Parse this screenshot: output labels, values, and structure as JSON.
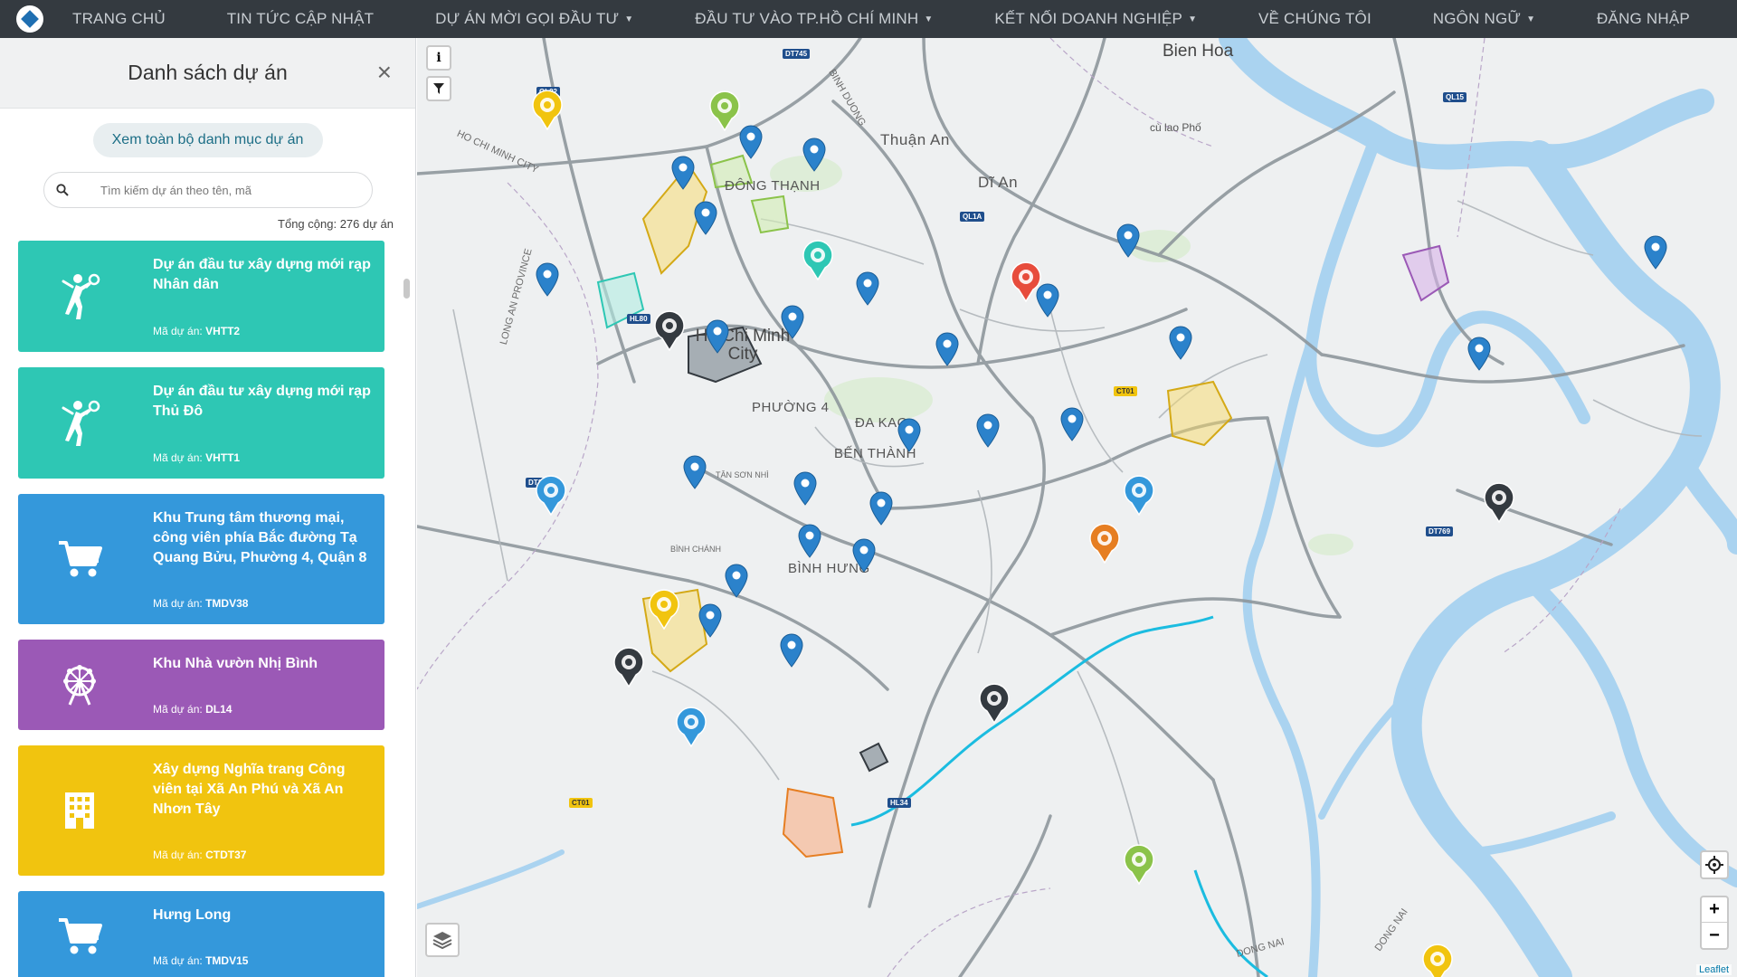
{
  "nav": {
    "items": [
      {
        "label": "TRANG CHỦ",
        "dropdown": false
      },
      {
        "label": "TIN TỨC CẬP NHẬT",
        "dropdown": false
      },
      {
        "label": "DỰ ÁN MỜI GỌI ĐẦU TƯ",
        "dropdown": true
      },
      {
        "label": "ĐẦU TƯ VÀO TP.HỒ CHÍ MINH",
        "dropdown": true
      },
      {
        "label": "KẾT NỐI DOANH NGHIỆP",
        "dropdown": true
      },
      {
        "label": "VỀ CHÚNG TÔI",
        "dropdown": false
      },
      {
        "label": "NGÔN NGỮ",
        "dropdown": true
      },
      {
        "label": "ĐĂNG NHẬP",
        "dropdown": false
      }
    ]
  },
  "sidebar": {
    "title": "Danh sách dự án",
    "catalog_button": "Xem toàn bộ danh mục dự án",
    "search_placeholder": "Tìm kiếm dự án theo tên, mã",
    "total": "Tổng cộng: 276 dự án",
    "code_label": "Mã dự án:",
    "projects": [
      {
        "title": "Dự án đầu tư xây dựng mới rạp Nhân dân",
        "code": "VHTT2",
        "color": "#2ec7b4",
        "icon": "badminton-player-icon"
      },
      {
        "title": "Dự án đầu tư xây dựng mới rạp Thủ Đô",
        "code": "VHTT1",
        "color": "#2ec7b4",
        "icon": "badminton-player-icon"
      },
      {
        "title": "Khu Trung tâm thương mại, công viên phía Bắc đường Tạ Quang Bửu, Phường 4, Quận 8",
        "code": "TMDV38",
        "color": "#3498db",
        "icon": "shopping-cart-icon"
      },
      {
        "title": "Khu Nhà vườn Nhị Bình",
        "code": "DL14",
        "color": "#9b59b6",
        "icon": "ferris-wheel-icon"
      },
      {
        "title": "Xây dựng Nghĩa trang Công viên tại Xã An Phú và Xã An Nhơn Tây",
        "code": "CTDT37",
        "color": "#f1c40f",
        "icon": "building-icon"
      },
      {
        "title": "Hưng Long",
        "code": "TMDV15",
        "color": "#3498db",
        "icon": "shopping-cart-icon"
      }
    ]
  },
  "map": {
    "labels": {
      "bien_hoa": "Bien Hoa",
      "thuan_an": "Thuận An",
      "di_an": "Dĩ An",
      "hcmc": "Ho Chi Minh City",
      "dong_thanh": "ĐÔNG THẠNH",
      "phuong4": "PHƯỜNG 4",
      "da_kao": "ĐA KAO",
      "ben_thanh": "BẾN THÀNH",
      "binh_hung": "BÌNH HƯNG",
      "cu_lao_pho": "cù lao Phố",
      "long_an": "LONG AN PROVINCE",
      "ho_chi_minh_city": "HO CHI MINH CITY",
      "dong_nai": "DONG NAI",
      "binh_duong": "BINH DUONG",
      "nhon_trach": "DONG NAI",
      "tan_son_nhi": "TÂN SƠN NHÌ",
      "binh_chanh": "BÌNH CHÁNH"
    },
    "attribution": "Leaflet",
    "controls": {
      "info": "i",
      "zoom_in": "+",
      "zoom_out": "−"
    }
  },
  "colors": {
    "teal": "#2ec7b4",
    "blue": "#3498db",
    "purple": "#9b59b6",
    "yellow": "#f1c40f",
    "nav_bg": "#343a40"
  }
}
